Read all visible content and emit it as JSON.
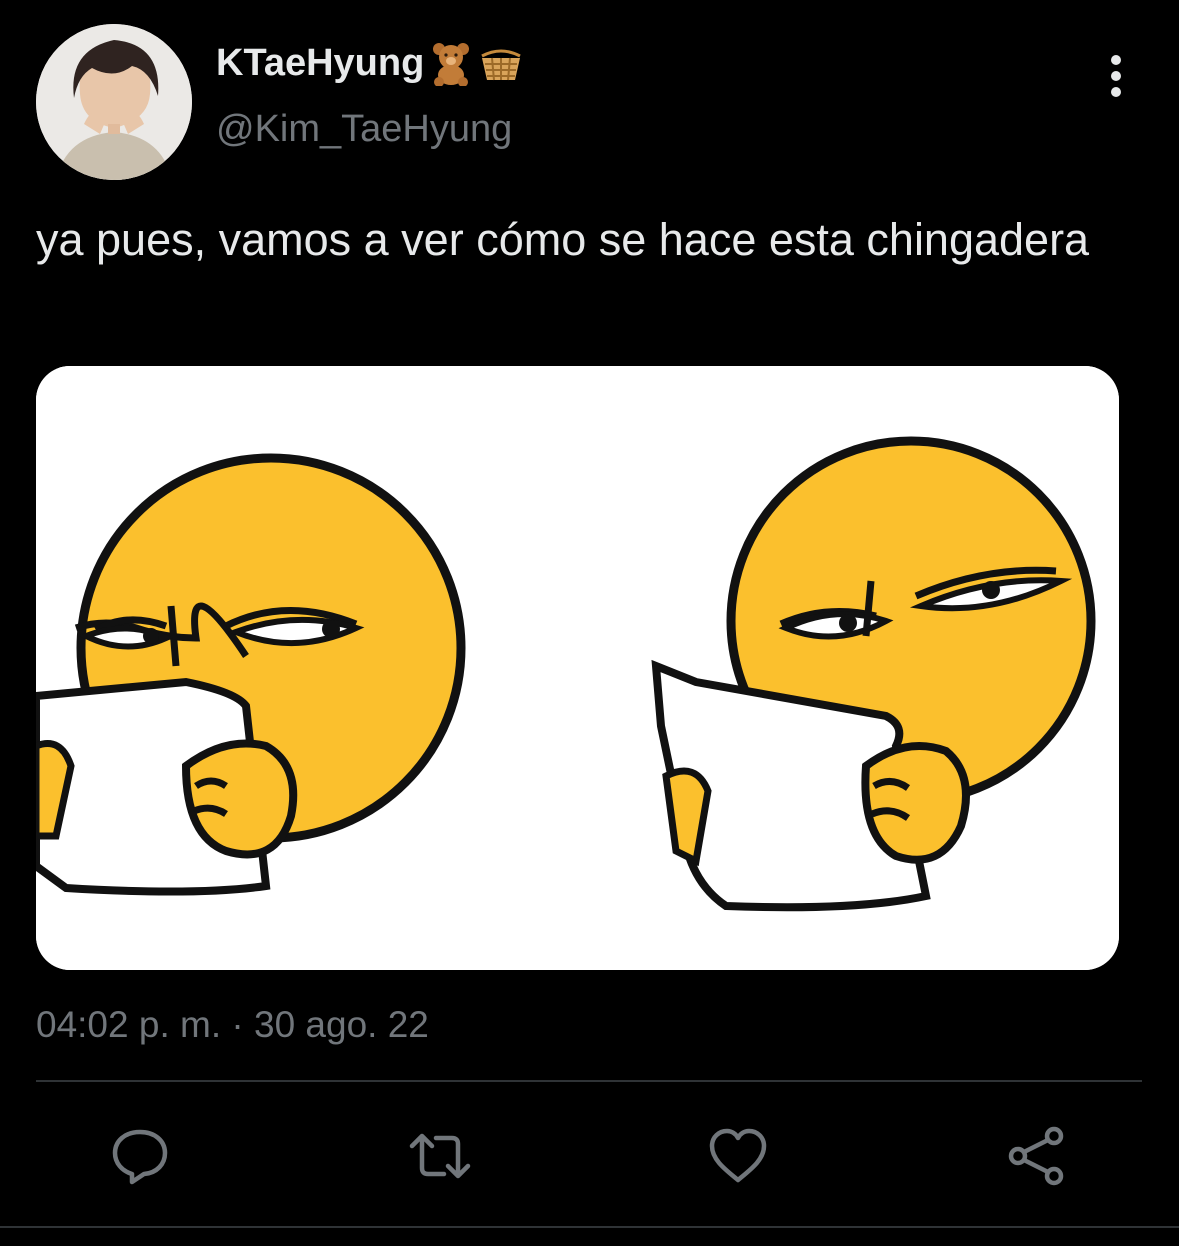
{
  "tweet": {
    "author": {
      "display_name": "KTaeHyung",
      "name_emojis": [
        "teddy-bear-icon",
        "basket-icon"
      ],
      "handle": "@Kim_TaeHyung"
    },
    "text": "ya pues, vamos a ver cómo se hace esta chingadera",
    "timestamp": "04:02 p. m. · 30 ago. 22"
  },
  "actions": [
    {
      "name": "reply",
      "icon": "reply-icon"
    },
    {
      "name": "retweet",
      "icon": "retweet-icon"
    },
    {
      "name": "like",
      "icon": "heart-icon"
    },
    {
      "name": "share",
      "icon": "share-icon"
    }
  ],
  "colors": {
    "background": "#000000",
    "primary_text": "#e7e9ea",
    "secondary_text": "#71767b",
    "divider": "#2f3336",
    "emoji_yellow": "#fbc02d"
  }
}
